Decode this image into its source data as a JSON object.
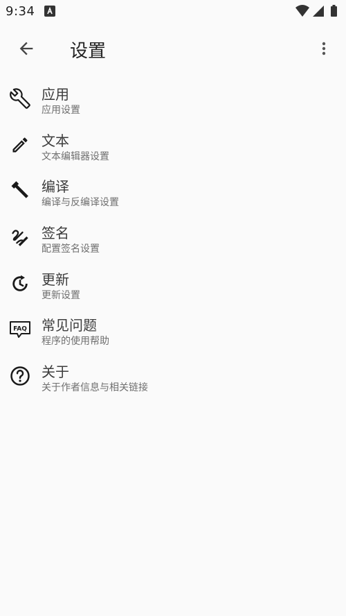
{
  "status_bar": {
    "time": "9:34",
    "app_icon": "notification-app-icon",
    "wifi_icon": "wifi-icon",
    "signal_icon": "cell-signal-icon",
    "battery_icon": "battery-icon"
  },
  "app_bar": {
    "back_icon": "arrow-back-icon",
    "title": "设置",
    "more_icon": "more-vert-icon"
  },
  "settings": [
    {
      "icon": "wrench-icon",
      "title": "应用",
      "subtitle": "应用设置"
    },
    {
      "icon": "pencil-icon",
      "title": "文本",
      "subtitle": "文本编辑器设置"
    },
    {
      "icon": "hammer-icon",
      "title": "编译",
      "subtitle": "编译与反编译设置"
    },
    {
      "icon": "signature-icon",
      "title": "签名",
      "subtitle": "配置签名设置"
    },
    {
      "icon": "update-icon",
      "title": "更新",
      "subtitle": "更新设置"
    },
    {
      "icon": "faq-icon",
      "title": "常见问题",
      "subtitle": "程序的使用帮助"
    },
    {
      "icon": "help-circle-icon",
      "title": "关于",
      "subtitle": "关于作者信息与相关链接"
    }
  ],
  "colors": {
    "background": "#fafafa",
    "text_primary": "#3c3c3c",
    "text_secondary": "#6f6f6f",
    "icon": "#1a1a1a"
  }
}
